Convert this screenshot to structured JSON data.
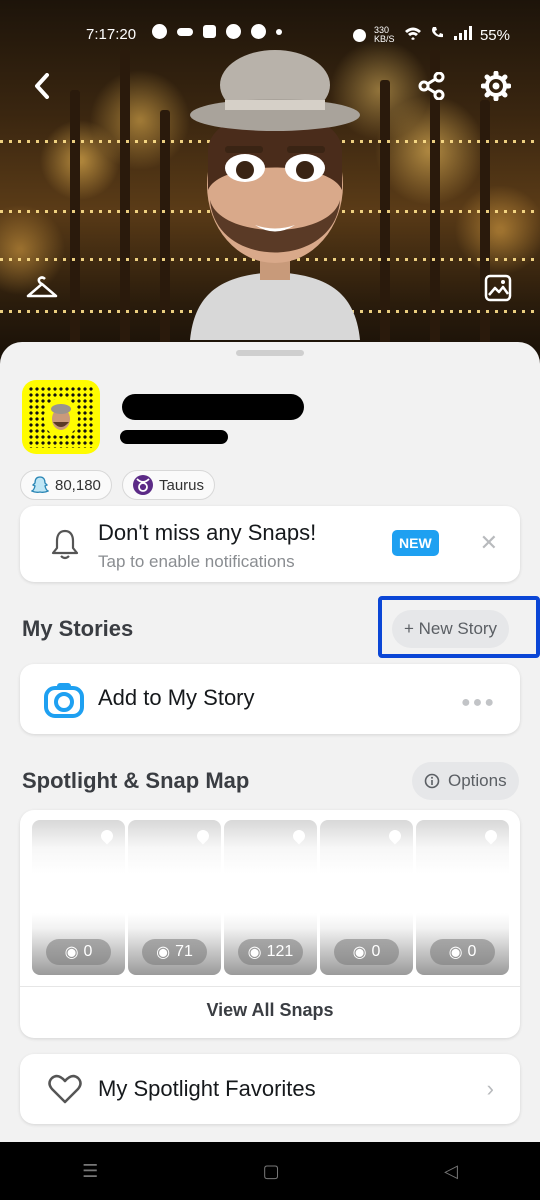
{
  "status_bar": {
    "time": "7:17:20",
    "network_speed": "330 KB/S",
    "battery": "55%"
  },
  "header": {
    "back_icon": "chevron-left-icon",
    "share_icon": "share-icon",
    "settings_icon": "gear-icon",
    "hanger_icon": "hanger-icon",
    "background_icon": "image-icon"
  },
  "profile": {
    "score": "80,180",
    "zodiac": "Taurus"
  },
  "notification_card": {
    "title": "Don't miss any Snaps!",
    "subtitle": "Tap to enable notifications",
    "badge": "NEW"
  },
  "my_stories": {
    "title": "My Stories",
    "new_story_label": "+ New Story",
    "add_story_label": "Add to My Story"
  },
  "spotlight": {
    "title": "Spotlight & Snap Map",
    "options_label": "Options",
    "tiles": [
      {
        "views": "0"
      },
      {
        "views": "71"
      },
      {
        "views": "121"
      },
      {
        "views": "0"
      },
      {
        "views": "0"
      }
    ],
    "view_all_label": "View All Snaps"
  },
  "favorites": {
    "label": "My Spotlight Favorites"
  },
  "colors": {
    "snap_yellow": "#fffc00",
    "accent_blue": "#1ea0f1",
    "annotation_blue": "#0b46d6"
  }
}
